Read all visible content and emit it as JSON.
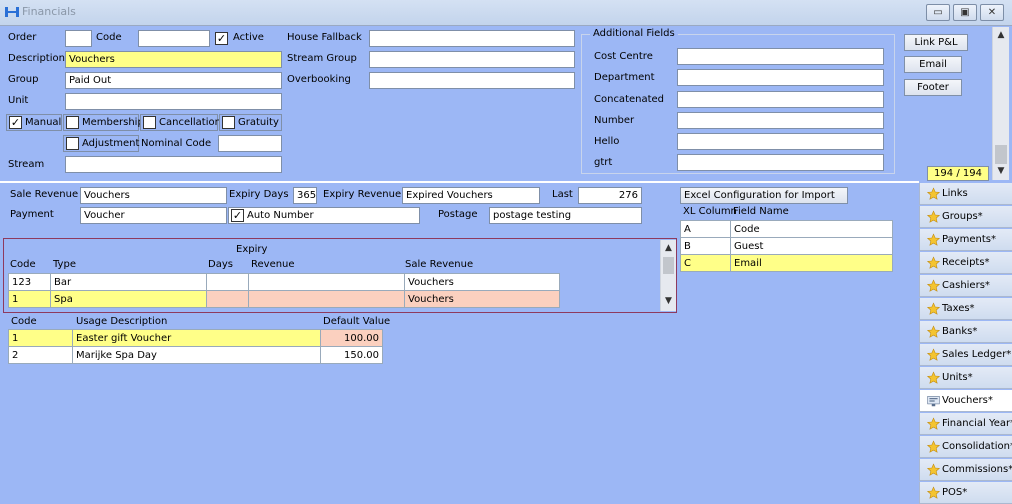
{
  "window": {
    "title": "Financials"
  },
  "header": {
    "order_label": "Order",
    "code_label": "Code",
    "active_label": "Active",
    "description_label": "Description",
    "description_value": "Vouchers",
    "group_label": "Group",
    "group_value": "Paid Out",
    "unit_label": "Unit",
    "stream_label": "Stream",
    "house_fallback_label": "House Fallback",
    "stream_group_label": "Stream Group",
    "overbooking_label": "Overbooking",
    "checkboxes": {
      "manual": "Manual",
      "membership": "Membership",
      "cancellation": "Cancellation",
      "gratuity": "Gratuity",
      "adjustment": "Adjustment"
    },
    "nominal_code_label": "Nominal Code"
  },
  "additional_fields": {
    "legend": "Additional Fields",
    "fields": [
      "Cost Centre",
      "Department",
      "Concatenated",
      "Number",
      "Hello",
      "gtrt"
    ]
  },
  "right_buttons": {
    "link_pl": "Link P&L",
    "email": "Email",
    "footer": "Footer"
  },
  "record_counter": "194 / 194",
  "voucher": {
    "sale_revenue_label": "Sale Revenue",
    "sale_revenue_value": "Vouchers",
    "expiry_days_label": "Expiry Days",
    "expiry_days_value": "365",
    "expiry_revenue_label": "Expiry Revenue",
    "expiry_revenue_value": "Expired Vouchers",
    "last_label": "Last",
    "last_value": "276",
    "payment_label": "Payment",
    "payment_value": "Voucher",
    "auto_number_label": "Auto Number",
    "postage_label": "Postage",
    "postage_value": "postage testing"
  },
  "types_table": {
    "group_header_expiry": "Expiry",
    "headers": {
      "code": "Code",
      "type": "Type",
      "days": "Days",
      "revenue": "Revenue",
      "sale_revenue": "Sale Revenue"
    },
    "rows": [
      {
        "code": "123",
        "type": "Bar",
        "days": "",
        "revenue": "",
        "sale_revenue": "Vouchers"
      },
      {
        "code": "1",
        "type": "Spa",
        "days": "",
        "revenue": "",
        "sale_revenue": "Vouchers"
      }
    ]
  },
  "usage_table": {
    "headers": {
      "code": "Code",
      "usage": "Usage Description",
      "default": "Default Value"
    },
    "rows": [
      {
        "code": "1",
        "usage": "Easter gift Voucher",
        "default": "100.00"
      },
      {
        "code": "2",
        "usage": "Marijke Spa Day",
        "default": "150.00"
      }
    ]
  },
  "excel_config": {
    "button": "Excel Configuration for Import",
    "headers": {
      "col": "XL Column",
      "field": "Field Name"
    },
    "rows": [
      {
        "col": "A",
        "field": "Code"
      },
      {
        "col": "B",
        "field": "Guest"
      },
      {
        "col": "C",
        "field": "Email"
      }
    ]
  },
  "side_tabs": [
    {
      "label": "Links",
      "icon": "star-icon"
    },
    {
      "label": "Groups*",
      "icon": "star-icon"
    },
    {
      "label": "Payments*",
      "icon": "star-icon"
    },
    {
      "label": "Receipts*",
      "icon": "star-icon"
    },
    {
      "label": "Cashiers*",
      "icon": "star-icon"
    },
    {
      "label": "Taxes*",
      "icon": "star-icon"
    },
    {
      "label": "Banks*",
      "icon": "star-icon"
    },
    {
      "label": "Sales Ledger*",
      "icon": "star-icon"
    },
    {
      "label": "Units*",
      "icon": "star-icon"
    },
    {
      "label": "Vouchers*",
      "icon": "voucher-icon"
    },
    {
      "label": "Financial Year*",
      "icon": "star-icon"
    },
    {
      "label": "Consolidation*",
      "icon": "star-icon"
    },
    {
      "label": "Commissions*",
      "icon": "star-icon"
    },
    {
      "label": "POS*",
      "icon": "star-icon"
    }
  ],
  "colors": {
    "background": "#9cb7f5",
    "highlight": "#ffff88",
    "peach": "#fbd0bf"
  }
}
